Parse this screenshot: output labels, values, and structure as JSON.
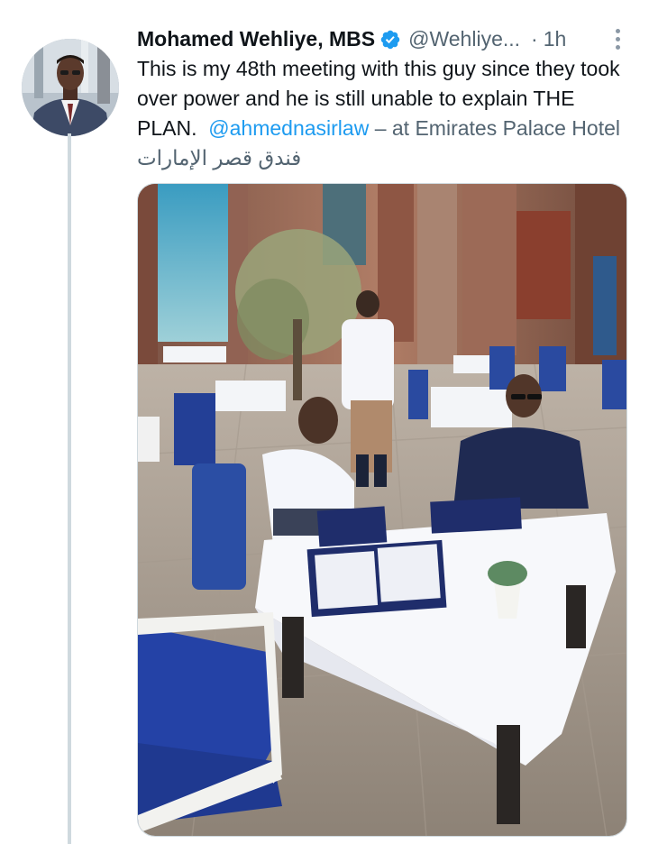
{
  "tweet": {
    "author": {
      "display_name": "Mohamed Wehliye, MBS",
      "handle": "@Wehliye...",
      "verified": true,
      "avatar_icon": "profile-photo"
    },
    "separator": "·",
    "time": "1h",
    "text": {
      "body": "This is my 48th meeting with this guy since they took over power and he is still unable to explain THE PLAN.",
      "mention": "@ahmednasirlaw",
      "location_prefix": " – at Emirates Palace Hotel ",
      "location_arabic": "فندق قصر الإمارات"
    },
    "media": {
      "type": "photo",
      "alt_icon": "terrace-photo"
    },
    "colors": {
      "link": "#1d9bf0",
      "secondary": "#536471",
      "verified": "#1d9bf0",
      "thread_line": "#cfd9de"
    }
  }
}
